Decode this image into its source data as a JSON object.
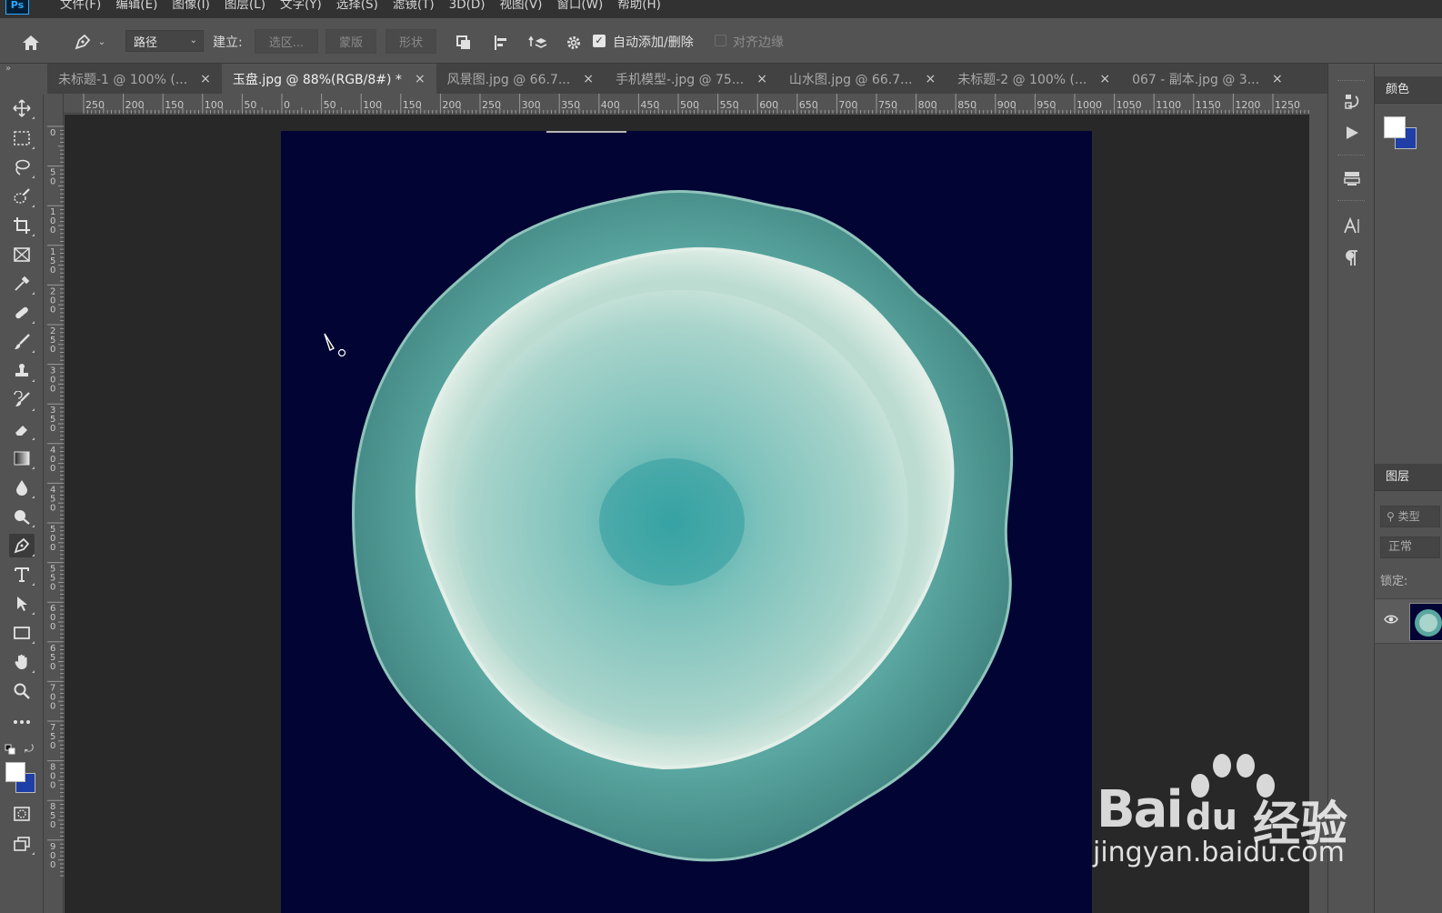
{
  "app": {
    "logo": "Ps"
  },
  "menu": [
    "文件(F)",
    "编辑(E)",
    "图像(I)",
    "图层(L)",
    "文字(Y)",
    "选择(S)",
    "滤镜(T)",
    "3D(D)",
    "视图(V)",
    "窗口(W)",
    "帮助(H)"
  ],
  "options": {
    "mode_value": "路径",
    "make_label": "建立:",
    "selection_btn": "选区...",
    "mask_btn": "蒙版",
    "shape_btn": "形状",
    "auto_add_label": "自动添加/删除",
    "auto_add_checked": true,
    "align_edges_label": "对齐边缘",
    "align_edges_checked": false
  },
  "tabs": [
    {
      "title": "未标题-1 @ 100% (...",
      "active": false
    },
    {
      "title": "玉盘.jpg @ 88%(RGB/8#) *",
      "active": true
    },
    {
      "title": "风景图.jpg @ 66.7...",
      "active": false
    },
    {
      "title": "手机模型-.jpg @ 75...",
      "active": false
    },
    {
      "title": "山水图.jpg @ 66.7...",
      "active": false
    },
    {
      "title": "未标题-2 @ 100% (...",
      "active": false
    },
    {
      "title": "067 - 副本.jpg @ 3...",
      "active": false
    }
  ],
  "tab_close": "×",
  "ruler": {
    "h_labels": [
      "250",
      "200",
      "150",
      "100",
      "50",
      "0",
      "50",
      "100",
      "150",
      "200",
      "250",
      "300",
      "350",
      "400",
      "450",
      "500",
      "550",
      "600",
      "650",
      "700",
      "750",
      "800",
      "850",
      "900",
      "950",
      "1000",
      "1050",
      "1100",
      "1150",
      "1200",
      "1250"
    ],
    "v_labels": [
      "0",
      "50",
      "100",
      "150",
      "200",
      "250",
      "300",
      "350",
      "400",
      "450",
      "500",
      "550",
      "600",
      "650",
      "700",
      "750",
      "800",
      "850",
      "900"
    ]
  },
  "colors": {
    "foreground": "#ffffff",
    "background": "#1f3fa6",
    "canvas_bg": "#020434"
  },
  "panels": {
    "color_title": "颜色",
    "layers_title": "图层",
    "layers_search": "类型",
    "blend_mode": "正常",
    "lock_label": "锁定:"
  },
  "watermark": {
    "brand": "Bai",
    "brand_du": "du",
    "product": "经验",
    "url": "jingyan.baidu.com"
  }
}
